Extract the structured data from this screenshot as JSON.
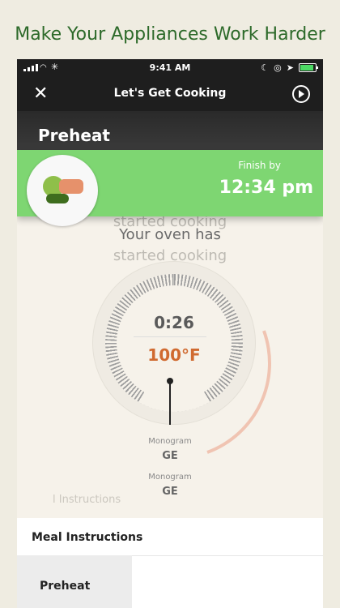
{
  "headline": "Make Your Appliances Work Harder",
  "status_bar": {
    "time": "9:41 AM",
    "icons": [
      "signal-icon",
      "wifi-icon",
      "loading-icon",
      "moon-icon",
      "alarm-icon",
      "location-icon",
      "battery-icon"
    ]
  },
  "nav": {
    "title": "Let's Get Cooking",
    "close_icon": "close-icon",
    "play_icon": "play-icon"
  },
  "step_title": "Preheat",
  "banner": {
    "finish_label": "Finish by",
    "finish_time": "12:34 pm",
    "image": "meal-photo",
    "color": "#7ed672"
  },
  "status_message": {
    "faded_top": "started cooking",
    "main": "Your oven has",
    "faded_bottom": "started cooking"
  },
  "dial": {
    "timer": "0:26",
    "temperature": "100°F",
    "temp_color": "#d06a30"
  },
  "appliances": [
    {
      "label": "Monogram",
      "name": "GE"
    },
    {
      "label": "Monogram",
      "name": "GE"
    }
  ],
  "faded_instructions": "l Instructions",
  "instructions_sheet": {
    "title": "Meal Instructions",
    "first_step": "Preheat"
  }
}
